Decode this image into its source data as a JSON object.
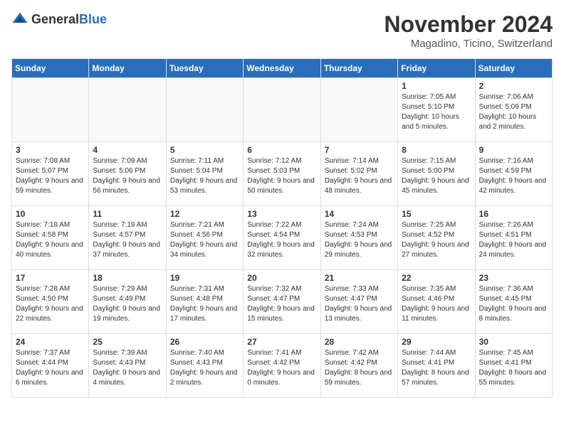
{
  "logo": {
    "general": "General",
    "blue": "Blue"
  },
  "header": {
    "month": "November 2024",
    "location": "Magadino, Ticino, Switzerland"
  },
  "days_of_week": [
    "Sunday",
    "Monday",
    "Tuesday",
    "Wednesday",
    "Thursday",
    "Friday",
    "Saturday"
  ],
  "weeks": [
    [
      {
        "day": "",
        "detail": ""
      },
      {
        "day": "",
        "detail": ""
      },
      {
        "day": "",
        "detail": ""
      },
      {
        "day": "",
        "detail": ""
      },
      {
        "day": "",
        "detail": ""
      },
      {
        "day": "1",
        "detail": "Sunrise: 7:05 AM\nSunset: 5:10 PM\nDaylight: 10 hours and 5 minutes."
      },
      {
        "day": "2",
        "detail": "Sunrise: 7:06 AM\nSunset: 5:09 PM\nDaylight: 10 hours and 2 minutes."
      }
    ],
    [
      {
        "day": "3",
        "detail": "Sunrise: 7:08 AM\nSunset: 5:07 PM\nDaylight: 9 hours and 59 minutes."
      },
      {
        "day": "4",
        "detail": "Sunrise: 7:09 AM\nSunset: 5:06 PM\nDaylight: 9 hours and 56 minutes."
      },
      {
        "day": "5",
        "detail": "Sunrise: 7:11 AM\nSunset: 5:04 PM\nDaylight: 9 hours and 53 minutes."
      },
      {
        "day": "6",
        "detail": "Sunrise: 7:12 AM\nSunset: 5:03 PM\nDaylight: 9 hours and 50 minutes."
      },
      {
        "day": "7",
        "detail": "Sunrise: 7:14 AM\nSunset: 5:02 PM\nDaylight: 9 hours and 48 minutes."
      },
      {
        "day": "8",
        "detail": "Sunrise: 7:15 AM\nSunset: 5:00 PM\nDaylight: 9 hours and 45 minutes."
      },
      {
        "day": "9",
        "detail": "Sunrise: 7:16 AM\nSunset: 4:59 PM\nDaylight: 9 hours and 42 minutes."
      }
    ],
    [
      {
        "day": "10",
        "detail": "Sunrise: 7:18 AM\nSunset: 4:58 PM\nDaylight: 9 hours and 40 minutes."
      },
      {
        "day": "11",
        "detail": "Sunrise: 7:19 AM\nSunset: 4:57 PM\nDaylight: 9 hours and 37 minutes."
      },
      {
        "day": "12",
        "detail": "Sunrise: 7:21 AM\nSunset: 4:56 PM\nDaylight: 9 hours and 34 minutes."
      },
      {
        "day": "13",
        "detail": "Sunrise: 7:22 AM\nSunset: 4:54 PM\nDaylight: 9 hours and 32 minutes."
      },
      {
        "day": "14",
        "detail": "Sunrise: 7:24 AM\nSunset: 4:53 PM\nDaylight: 9 hours and 29 minutes."
      },
      {
        "day": "15",
        "detail": "Sunrise: 7:25 AM\nSunset: 4:52 PM\nDaylight: 9 hours and 27 minutes."
      },
      {
        "day": "16",
        "detail": "Sunrise: 7:26 AM\nSunset: 4:51 PM\nDaylight: 9 hours and 24 minutes."
      }
    ],
    [
      {
        "day": "17",
        "detail": "Sunrise: 7:28 AM\nSunset: 4:50 PM\nDaylight: 9 hours and 22 minutes."
      },
      {
        "day": "18",
        "detail": "Sunrise: 7:29 AM\nSunset: 4:49 PM\nDaylight: 9 hours and 19 minutes."
      },
      {
        "day": "19",
        "detail": "Sunrise: 7:31 AM\nSunset: 4:48 PM\nDaylight: 9 hours and 17 minutes."
      },
      {
        "day": "20",
        "detail": "Sunrise: 7:32 AM\nSunset: 4:47 PM\nDaylight: 9 hours and 15 minutes."
      },
      {
        "day": "21",
        "detail": "Sunrise: 7:33 AM\nSunset: 4:47 PM\nDaylight: 9 hours and 13 minutes."
      },
      {
        "day": "22",
        "detail": "Sunrise: 7:35 AM\nSunset: 4:46 PM\nDaylight: 9 hours and 11 minutes."
      },
      {
        "day": "23",
        "detail": "Sunrise: 7:36 AM\nSunset: 4:45 PM\nDaylight: 9 hours and 8 minutes."
      }
    ],
    [
      {
        "day": "24",
        "detail": "Sunrise: 7:37 AM\nSunset: 4:44 PM\nDaylight: 9 hours and 6 minutes."
      },
      {
        "day": "25",
        "detail": "Sunrise: 7:39 AM\nSunset: 4:43 PM\nDaylight: 9 hours and 4 minutes."
      },
      {
        "day": "26",
        "detail": "Sunrise: 7:40 AM\nSunset: 4:43 PM\nDaylight: 9 hours and 2 minutes."
      },
      {
        "day": "27",
        "detail": "Sunrise: 7:41 AM\nSunset: 4:42 PM\nDaylight: 9 hours and 0 minutes."
      },
      {
        "day": "28",
        "detail": "Sunrise: 7:42 AM\nSunset: 4:42 PM\nDaylight: 8 hours and 59 minutes."
      },
      {
        "day": "29",
        "detail": "Sunrise: 7:44 AM\nSunset: 4:41 PM\nDaylight: 8 hours and 57 minutes."
      },
      {
        "day": "30",
        "detail": "Sunrise: 7:45 AM\nSunset: 4:41 PM\nDaylight: 8 hours and 55 minutes."
      }
    ]
  ]
}
